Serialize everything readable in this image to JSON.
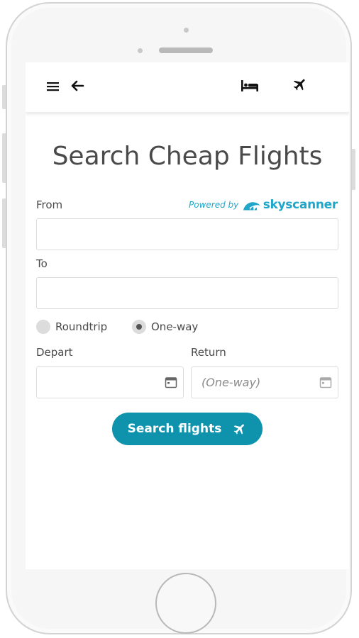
{
  "colors": {
    "accent": "#0f93ac",
    "brand": "#1fa6c9",
    "text": "#4a4a4a"
  },
  "topbar": {
    "icons": [
      "menu-icon",
      "back-arrow-icon",
      "bed-icon",
      "airplane-icon"
    ]
  },
  "page": {
    "title": "Search Cheap Flights"
  },
  "powered_by": {
    "prefix": "Powered by",
    "brand": "skyscanner"
  },
  "form": {
    "from_label": "From",
    "from_value": "",
    "to_label": "To",
    "to_value": "",
    "trip_type": {
      "options": [
        {
          "label": "Roundtrip",
          "selected": false
        },
        {
          "label": "One-way",
          "selected": true
        }
      ]
    },
    "depart_label": "Depart",
    "depart_value": "",
    "return_label": "Return",
    "return_placeholder": "(One-way)",
    "search_button_label": "Search flights"
  }
}
